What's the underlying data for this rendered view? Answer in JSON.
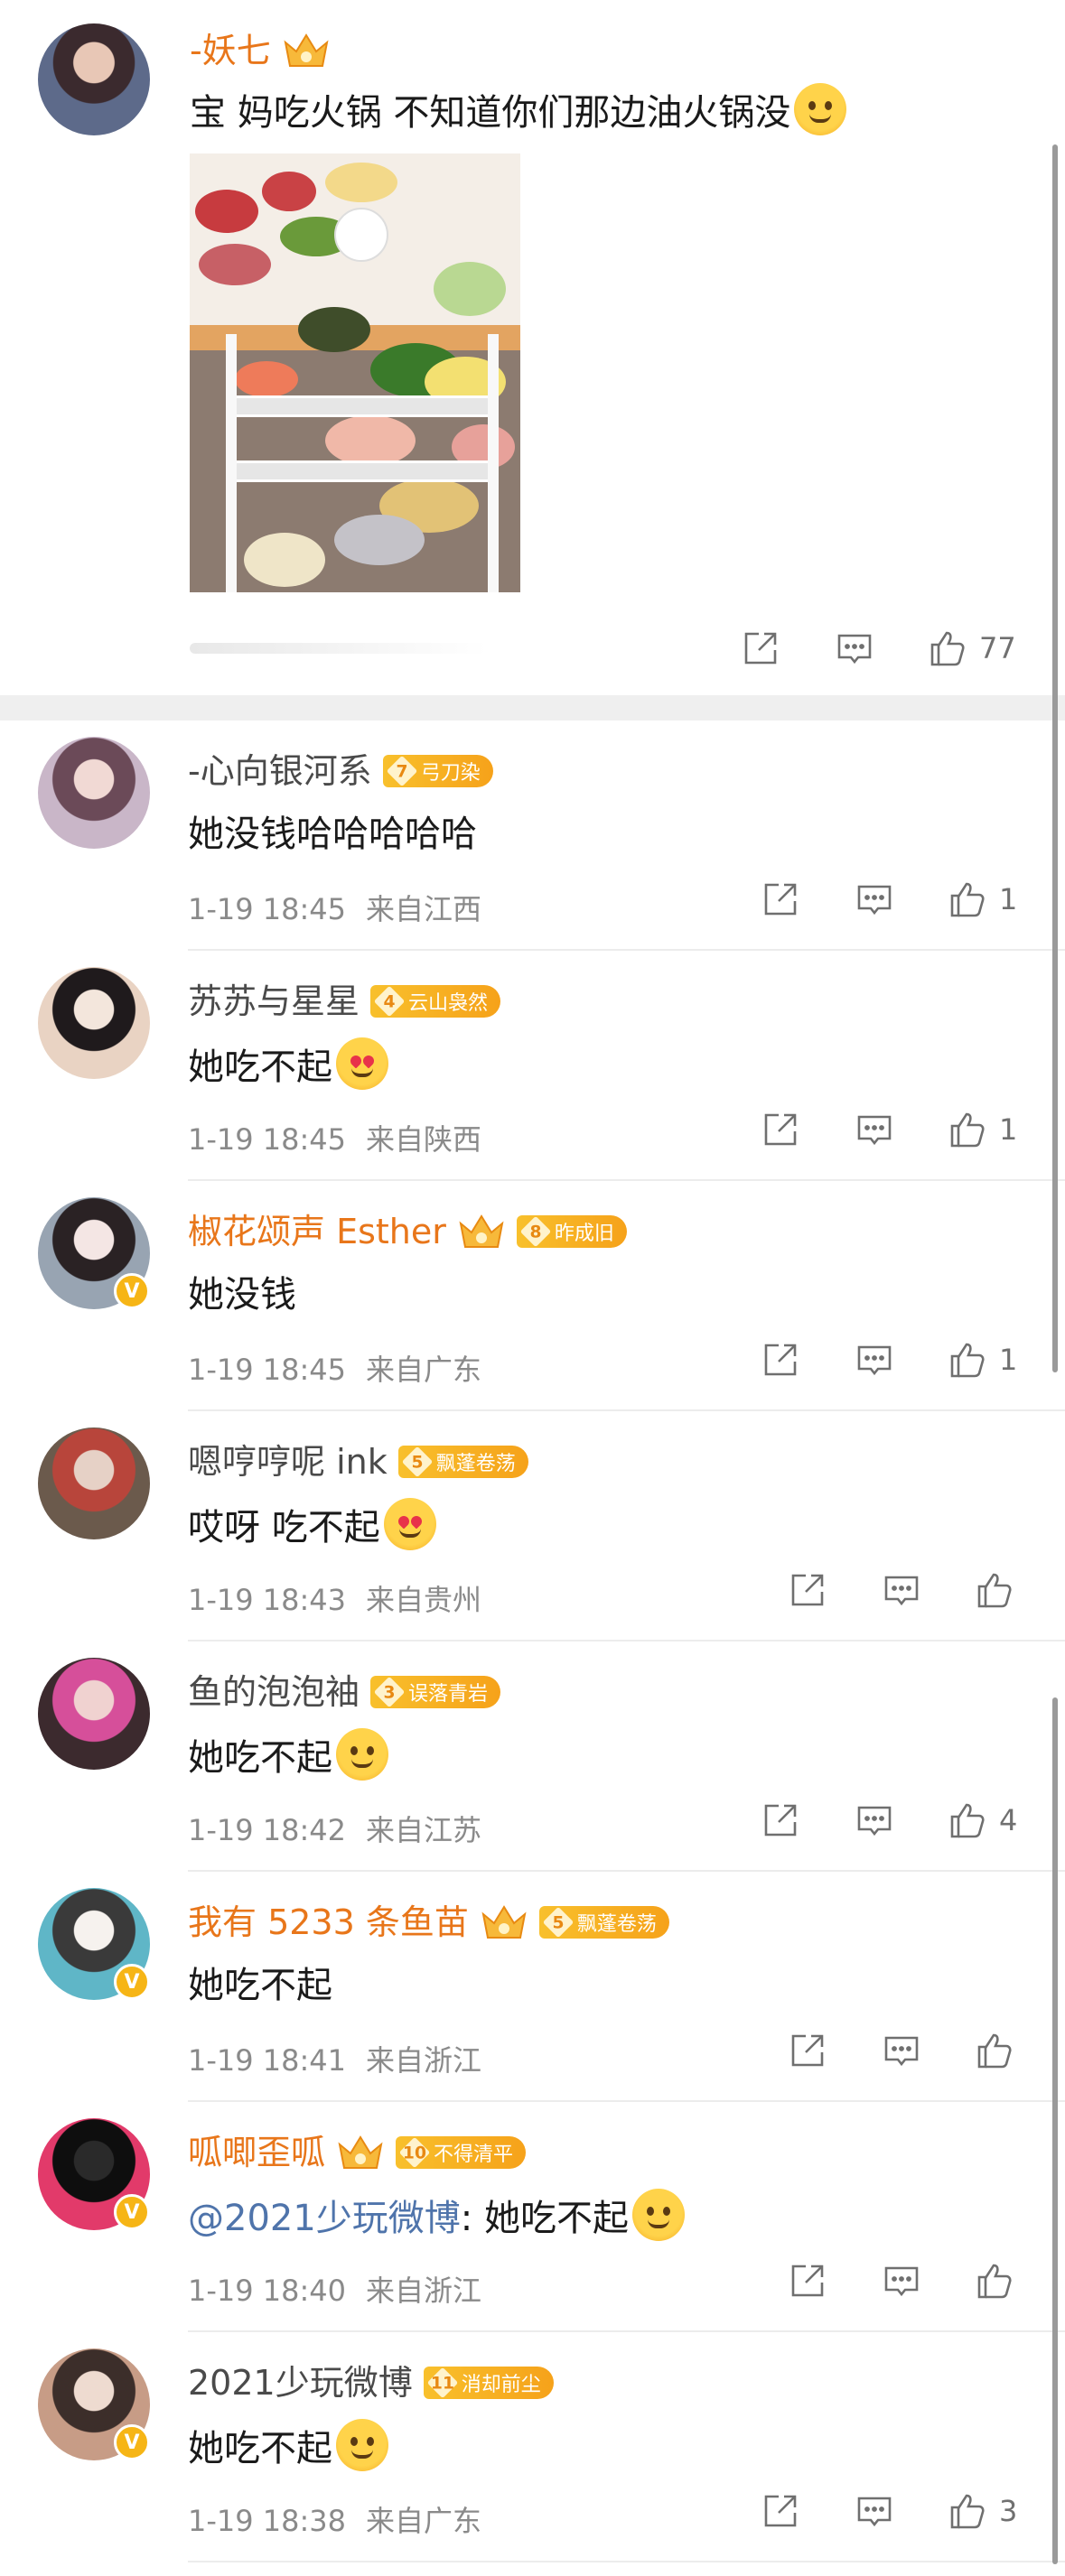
{
  "post": {
    "username": "-妖七",
    "text": "宝 妈吃火锅 不知道你们那边油火锅没",
    "like_count": "77"
  },
  "comments": [
    {
      "username": "-心向银河系",
      "name_color": "gray",
      "crown": false,
      "verified": false,
      "fan_level": "7",
      "fan_title": "弓刀染",
      "mention": "",
      "text": "她没钱哈哈哈哈哈",
      "emoji": "",
      "time": "1-19 18:45",
      "location": "来自江西",
      "likes": "1",
      "avatar_colors": [
        "#f1d9d4",
        "#6b4a58",
        "#c9b6c8"
      ]
    },
    {
      "username": "苏苏与星星",
      "name_color": "gray",
      "crown": false,
      "verified": false,
      "fan_level": "4",
      "fan_title": "云山袅然",
      "mention": "",
      "text": "她吃不起",
      "emoji": "love",
      "time": "1-19 18:45",
      "location": "来自陕西",
      "likes": "1",
      "avatar_colors": [
        "#f3e6dc",
        "#1f1a1c",
        "#e9d3c3"
      ]
    },
    {
      "username": "椒花颂声 Esther",
      "name_color": "orange",
      "crown": true,
      "verified": true,
      "fan_level": "8",
      "fan_title": "昨成旧",
      "mention": "",
      "text": "她没钱",
      "emoji": "",
      "time": "1-19 18:45",
      "location": "来自广东",
      "likes": "1",
      "avatar_colors": [
        "#f4e6e4",
        "#2a2224",
        "#98a4b2"
      ]
    },
    {
      "username": "嗯哼哼呢 ink",
      "name_color": "gray",
      "crown": false,
      "verified": false,
      "fan_level": "5",
      "fan_title": "飘蓬卷荡",
      "mention": "",
      "text": "哎呀 吃不起",
      "emoji": "love",
      "time": "1-19 18:43",
      "location": "来自贵州",
      "likes": "",
      "avatar_colors": [
        "#e6d1c6",
        "#b8453b",
        "#6b5a4c"
      ]
    },
    {
      "username": "鱼的泡泡袖",
      "name_color": "gray",
      "crown": false,
      "verified": false,
      "fan_level": "3",
      "fan_title": "误落青岩",
      "mention": "",
      "text": "她吃不起",
      "emoji": "tongue",
      "time": "1-19 18:42",
      "location": "来自江苏",
      "likes": "4",
      "avatar_colors": [
        "#f0d2d0",
        "#d64f9a",
        "#3c2a2e"
      ]
    },
    {
      "username": "我有 5233 条鱼苗",
      "name_color": "orange",
      "crown": true,
      "verified": true,
      "fan_level": "5",
      "fan_title": "飘蓬卷荡",
      "mention": "",
      "text": "她吃不起",
      "emoji": "",
      "time": "1-19 18:41",
      "location": "来自浙江",
      "likes": "",
      "avatar_colors": [
        "#f6f2ee",
        "#3a3a3a",
        "#5fb6c7"
      ]
    },
    {
      "username": "呱唧歪呱",
      "name_color": "orange",
      "crown": true,
      "verified": true,
      "fan_level": "10",
      "fan_title": "不得清平",
      "mention": "@2021少玩微博",
      "text": ": 她吃不起",
      "emoji": "grin",
      "time": "1-19 18:40",
      "location": "来自浙江",
      "likes": "",
      "avatar_colors": [
        "#2a2a2a",
        "#0e0e0e",
        "#e23a6a"
      ]
    },
    {
      "username": "2021少玩微博",
      "name_color": "gray",
      "crown": false,
      "verified": true,
      "fan_level": "11",
      "fan_title": "消却前尘",
      "mention": "",
      "text": "她吃不起",
      "emoji": "grin",
      "time": "1-19 18:38",
      "location": "来自广东",
      "likes": "3",
      "avatar_colors": [
        "#eedbd0",
        "#3c2e2a",
        "#c79c86"
      ]
    }
  ],
  "colors": {
    "accent_orange": "#e8761a",
    "mention_blue": "#4f74ab",
    "fan_badge": "#f6a21a",
    "meta_gray": "#8a8a8a"
  },
  "icons": [
    "share-icon",
    "comment-icon",
    "like-icon",
    "crown-badge-icon",
    "verified-v-icon"
  ]
}
